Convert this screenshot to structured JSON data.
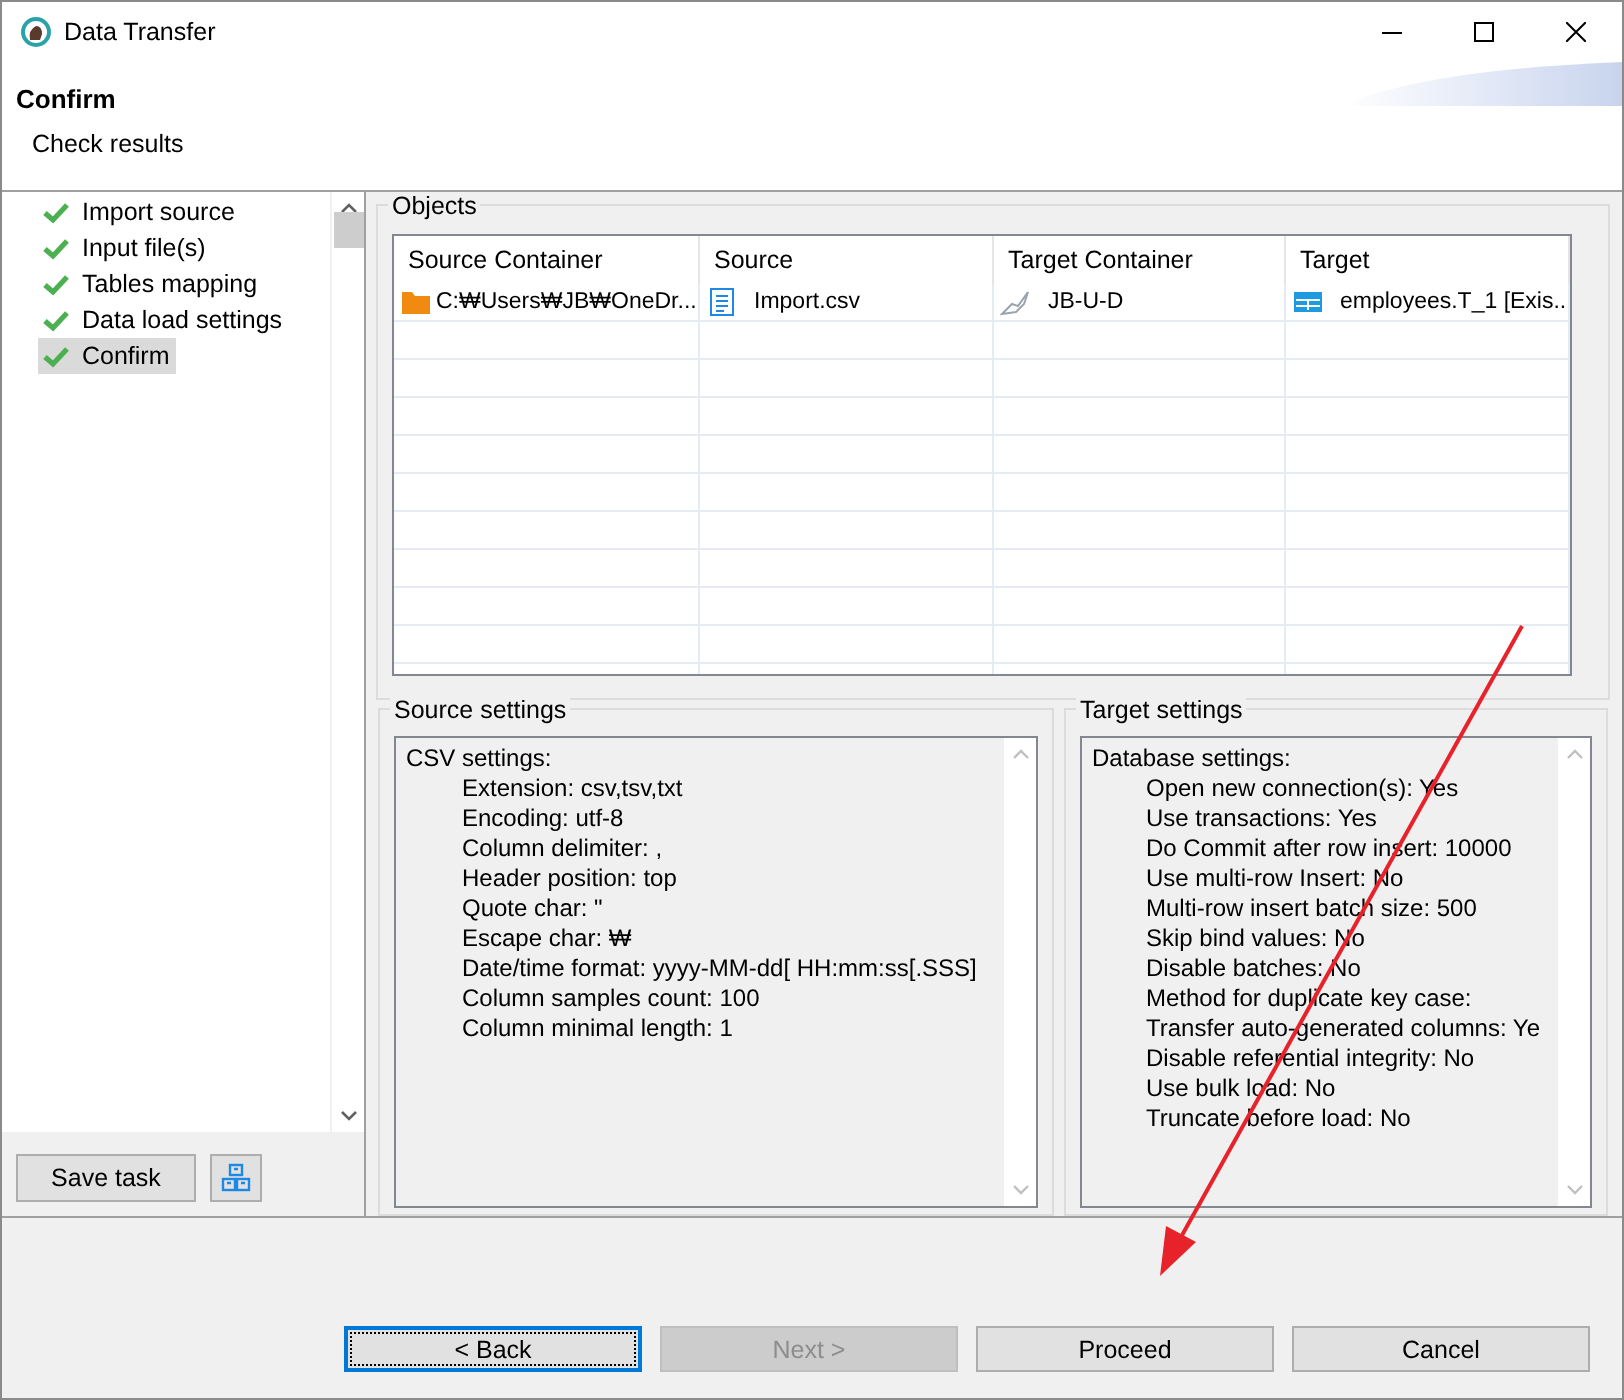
{
  "window": {
    "title": "Data Transfer"
  },
  "header": {
    "title": "Confirm",
    "subtitle": "Check results"
  },
  "steps": [
    {
      "label": "Import source",
      "done": true,
      "selected": false
    },
    {
      "label": "Input file(s)",
      "done": true,
      "selected": false
    },
    {
      "label": "Tables mapping",
      "done": true,
      "selected": false
    },
    {
      "label": "Data load settings",
      "done": true,
      "selected": false
    },
    {
      "label": "Confirm",
      "done": true,
      "selected": true
    }
  ],
  "save_task": {
    "label": "Save task"
  },
  "objects": {
    "title": "Objects",
    "columns": [
      "Source Container",
      "Source",
      "Target Container",
      "Target"
    ],
    "rows": [
      [
        {
          "kind": "folder",
          "text": "C:₩Users₩JB₩OneDr..."
        },
        {
          "kind": "document",
          "text": "Import.csv"
        },
        {
          "kind": "connection",
          "text": "JB-U-D"
        },
        {
          "kind": "table",
          "text": "employees.T_1  [Exis..."
        }
      ]
    ]
  },
  "source_settings": {
    "title": "Source settings",
    "heading": "CSV settings:",
    "lines": [
      "Extension: csv,tsv,txt",
      "Encoding: utf-8",
      "Column delimiter: ,",
      "Header position: top",
      "Quote char: \"",
      "Escape char: ₩",
      "Date/time format: yyyy-MM-dd[ HH:mm:ss[.SSS]",
      "Column samples count: 100",
      "Column minimal length: 1"
    ]
  },
  "target_settings": {
    "title": "Target settings",
    "heading": "Database settings:",
    "lines": [
      "Open new connection(s): Yes",
      "Use transactions: Yes",
      "Do Commit after row insert: 10000",
      "Use multi-row Insert: No",
      "Multi-row insert batch size: 500",
      "Skip bind values: No",
      "Disable batches: No",
      "Method for duplicate key case:",
      "Transfer auto-generated columns: Ye",
      "Disable referential integrity: No",
      "Use bulk load: No",
      "Truncate before load: No"
    ]
  },
  "buttons": [
    {
      "label": "< Back",
      "disabled": false,
      "focused": true
    },
    {
      "label": "Next >",
      "disabled": true,
      "focused": false
    },
    {
      "label": "Proceed",
      "disabled": false,
      "focused": false
    },
    {
      "label": "Cancel",
      "disabled": false,
      "focused": false
    }
  ]
}
